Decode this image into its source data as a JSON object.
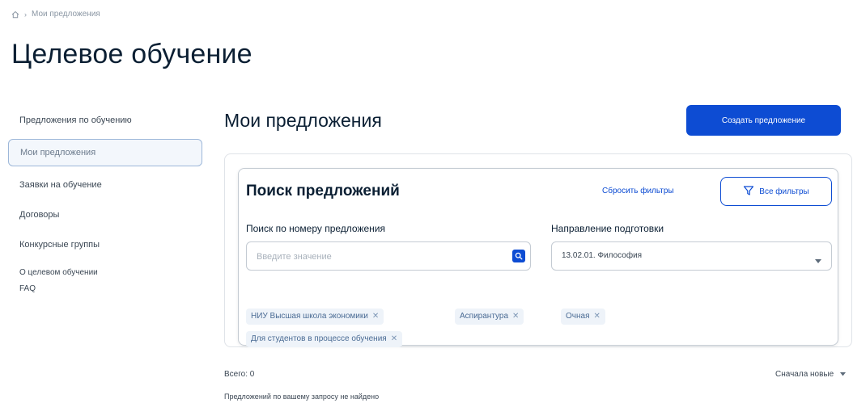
{
  "breadcrumb": {
    "home_icon": "home-icon",
    "separator": "›",
    "current": "Мои предложения"
  },
  "page_title": "Целевое обучение",
  "sidebar": {
    "items": [
      {
        "label": "Предложения по обучению"
      },
      {
        "label": "Мои предложения",
        "active": true
      },
      {
        "label": "Заявки на обучение"
      },
      {
        "label": "Договоры"
      },
      {
        "label": "Конкурсные группы"
      },
      {
        "label": "О целевом обучении"
      },
      {
        "label": "FAQ"
      }
    ]
  },
  "section_title": "Мои предложения",
  "create_button": "Создать предложение",
  "search": {
    "title": "Поиск предложений",
    "reset_label": "Сбросить фильтры",
    "all_filters_label": "Все фильтры",
    "number_label": "Поиск по номеру предложения",
    "number_placeholder": "Введите значение",
    "direction_label": "Направление подготовки",
    "direction_value": "13.02.01. Философия"
  },
  "chips": [
    {
      "label": "НИУ Высшая школа экономики"
    },
    {
      "label": "Аспирантура"
    },
    {
      "label": "Очная"
    },
    {
      "label": "Для студентов в процессе обучения"
    }
  ],
  "results": {
    "total": "Всего: 0",
    "sort_label": "Сначала новые",
    "not_found": "Предложений по вашему запросу не найдено"
  },
  "colors": {
    "primary": "#0d4cd3",
    "text": "#0b1f33",
    "chip_bg": "#eef3f9"
  }
}
